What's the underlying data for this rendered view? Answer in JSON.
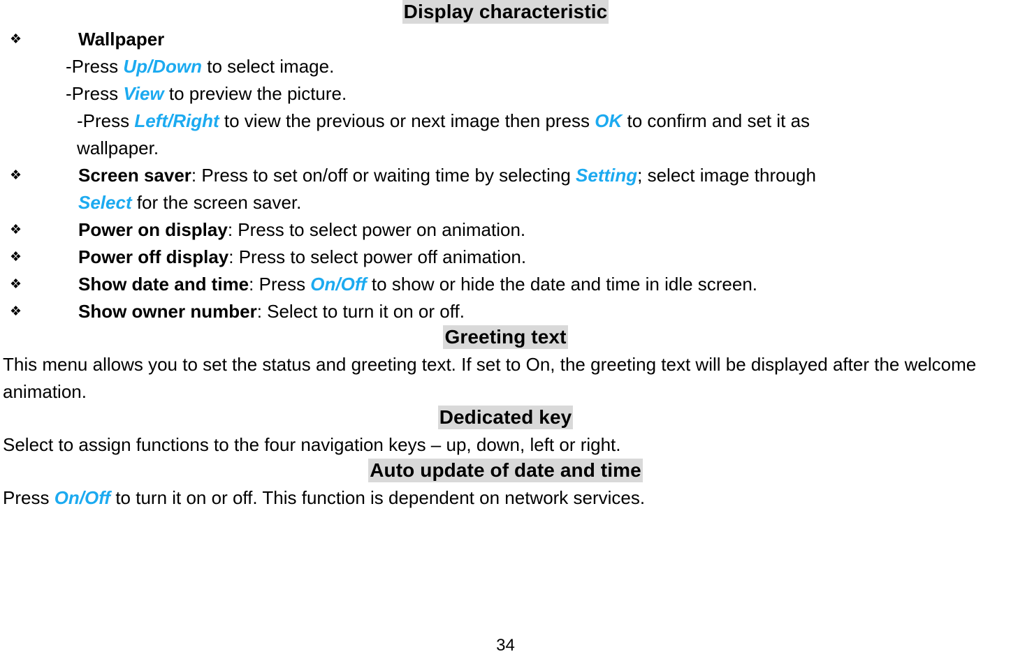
{
  "document": {
    "page_number": "34",
    "accent_blue": "#1CAAF0",
    "highlight_gray": "#d9d9d9"
  },
  "sections": {
    "display_characteristic": {
      "heading": "Display characteristic",
      "bullets": {
        "wallpaper": {
          "marker": "❖",
          "term": "Wallpaper",
          "sub_lines": {
            "line1": {
              "prefix": "-Press ",
              "key": "Up/Down",
              "suffix": " to select image."
            },
            "line2": {
              "prefix": "-Press ",
              "key": "View",
              "suffix": " to preview the picture."
            },
            "line3": {
              "prefix": "-Press ",
              "key": "Left/Right",
              "middle": " to view the previous or next image then press ",
              "key2": "OK",
              "suffix": " to confirm and set it as"
            },
            "line4": "wallpaper."
          }
        },
        "screen_saver": {
          "marker": "❖",
          "term": "Screen saver",
          "text_1": ": Press to set on/off or waiting time by selecting ",
          "key_1": "Setting",
          "text_2": "; select image through",
          "key_2": "Select",
          "text_3": " for the screen saver."
        },
        "power_on_display": {
          "marker": "❖",
          "term": "Power on display",
          "text": ": Press to select power on animation."
        },
        "power_off_display": {
          "marker": "❖",
          "term": "Power off display",
          "text": ": Press to select power off animation."
        },
        "show_date_and_time": {
          "marker": "❖",
          "term": "Show date and time",
          "text_1": ": Press ",
          "key_1": "On/Off",
          "text_2": " to show or hide the date and time in idle screen."
        },
        "show_owner_number": {
          "marker": "❖",
          "term": "Show owner number",
          "text": ": Select to turn it on or off."
        }
      }
    },
    "greeting_text": {
      "heading": "Greeting text",
      "paragraph": "This menu allows you to set the status and greeting text. If set to On, the greeting text will be displayed after the welcome animation."
    },
    "dedicated_key": {
      "heading": "Dedicated key",
      "paragraph": "Select to assign functions to the four navigation keys – up, down, left or right."
    },
    "auto_update_of_date_and_time": {
      "heading": "Auto update of date and time",
      "text_1": "Press ",
      "key_1": "On/Off",
      "text_2": " to turn it on or off. This function is dependent on network services."
    }
  }
}
